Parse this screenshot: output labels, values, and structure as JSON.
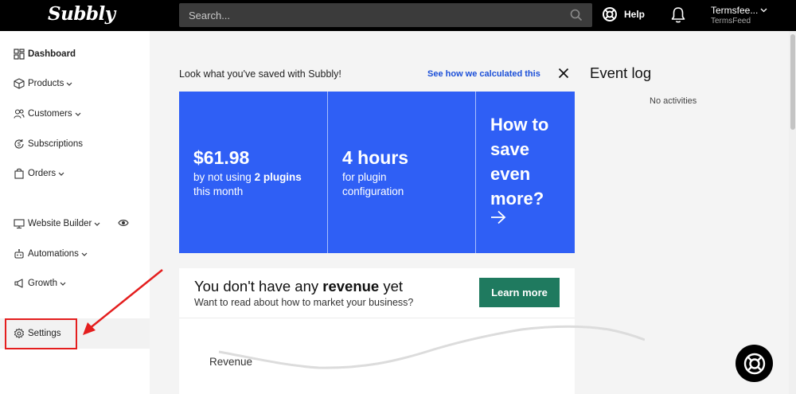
{
  "header": {
    "logo": "Subbly",
    "search_placeholder": "Search...",
    "help_label": "Help",
    "account_name": "Termsfee...",
    "account_sub": "TermsFeed"
  },
  "sidebar": {
    "items": [
      {
        "label": "Dashboard"
      },
      {
        "label": "Products"
      },
      {
        "label": "Customers"
      },
      {
        "label": "Subscriptions"
      },
      {
        "label": "Orders"
      },
      {
        "label": "Website Builder"
      },
      {
        "label": "Automations"
      },
      {
        "label": "Growth"
      },
      {
        "label": "Settings"
      }
    ]
  },
  "savings": {
    "title": "Look what you've saved with Subbly!",
    "link": "See how we calculated this",
    "card1": {
      "value": "$61.98",
      "line1_pre": "by not using ",
      "line1_bold": "2 plugins",
      "line2": "this month"
    },
    "card2": {
      "value": "4 hours",
      "line1": "for plugin",
      "line2": "configuration"
    },
    "card3": {
      "text": "How to save even more?"
    }
  },
  "revenue": {
    "title_pre": "You don't have any ",
    "title_bold": "revenue",
    "title_post": " yet",
    "subtitle": "Want to read about how to market your business?",
    "button": "Learn more",
    "chart_label": "Revenue"
  },
  "event_log": {
    "title": "Event log",
    "empty": "No activities"
  },
  "colors": {
    "accent_blue": "#2f5ff5",
    "learn_green": "#1f7a5f",
    "annotation_red": "#e41e1e"
  }
}
